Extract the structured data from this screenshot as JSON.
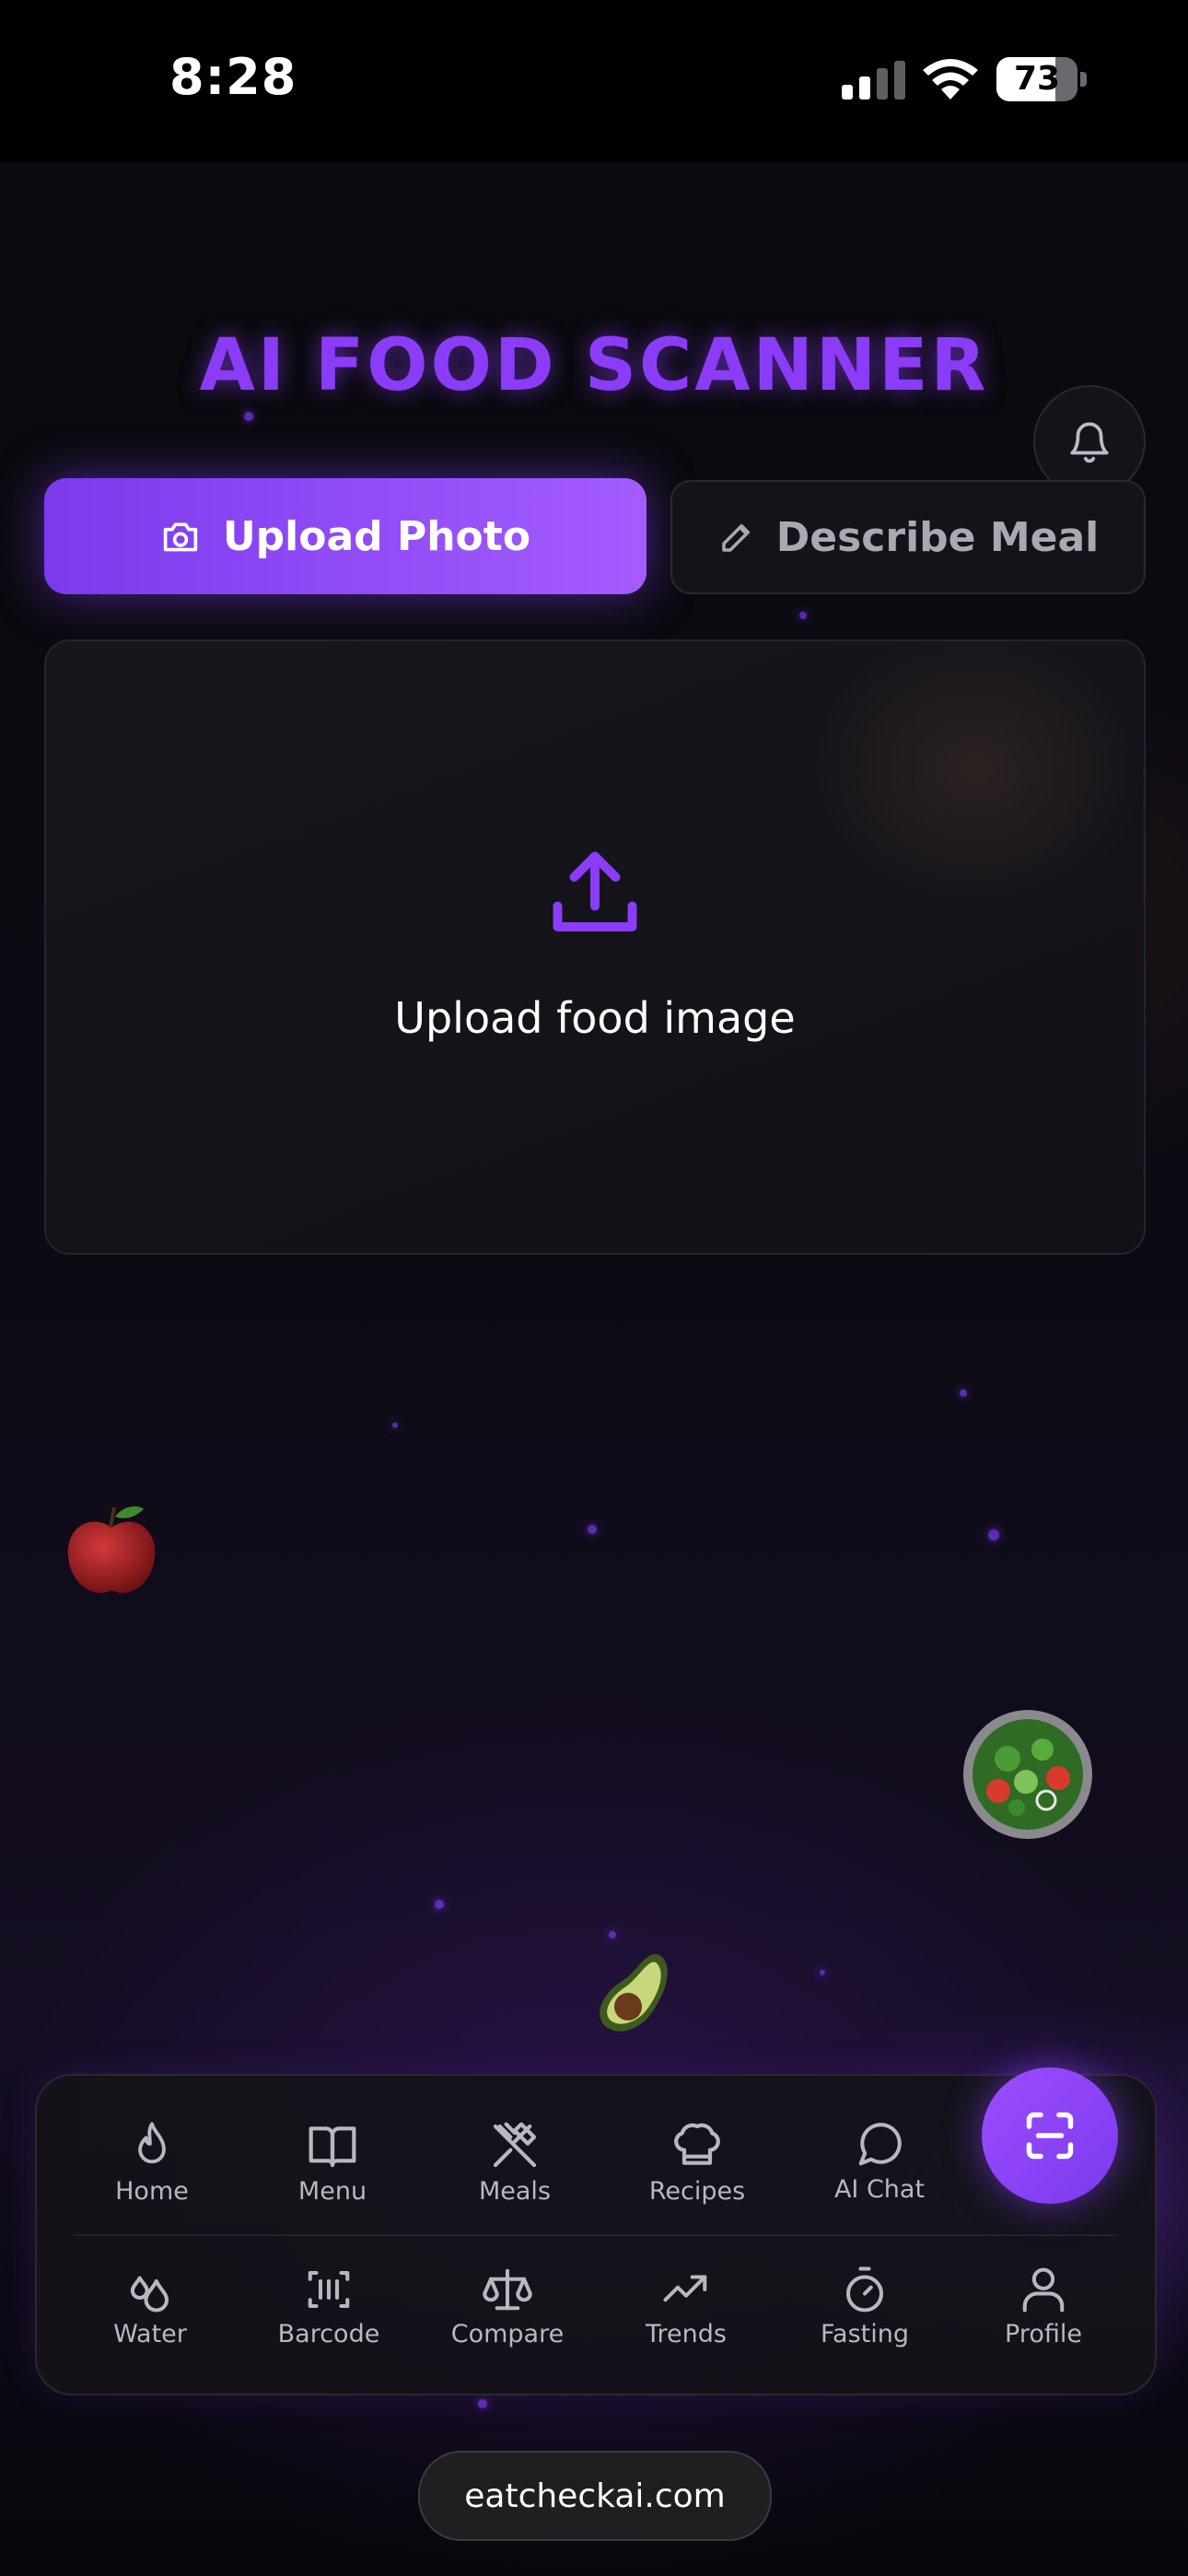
{
  "status_bar": {
    "time": "8:28",
    "battery": "73",
    "battery_level": 0.73
  },
  "app": {
    "title": "AI FOOD SCANNER"
  },
  "tabs": {
    "upload_label": "Upload Photo",
    "describe_label": "Describe Meal"
  },
  "upload_zone": {
    "label": "Upload food image"
  },
  "nav": {
    "row1": [
      {
        "label": "Home",
        "icon": "flame-icon"
      },
      {
        "label": "Menu",
        "icon": "book-icon"
      },
      {
        "label": "Meals",
        "icon": "utensils-icon"
      },
      {
        "label": "Recipes",
        "icon": "chef-hat-icon"
      },
      {
        "label": "AI Chat",
        "icon": "chat-icon"
      }
    ],
    "row2": [
      {
        "label": "Water",
        "icon": "droplets-icon"
      },
      {
        "label": "Barcode",
        "icon": "barcode-icon"
      },
      {
        "label": "Compare",
        "icon": "scale-icon"
      },
      {
        "label": "Trends",
        "icon": "trend-icon"
      },
      {
        "label": "Fasting",
        "icon": "timer-icon"
      },
      {
        "label": "Profile",
        "icon": "user-icon"
      }
    ],
    "scan_button_icon": "scan-icon"
  },
  "browser": {
    "url": "eatcheckai.com"
  },
  "colors": {
    "accent": "#8b3cf7",
    "accent_light": "#a35cff",
    "background": "#0a090e"
  }
}
